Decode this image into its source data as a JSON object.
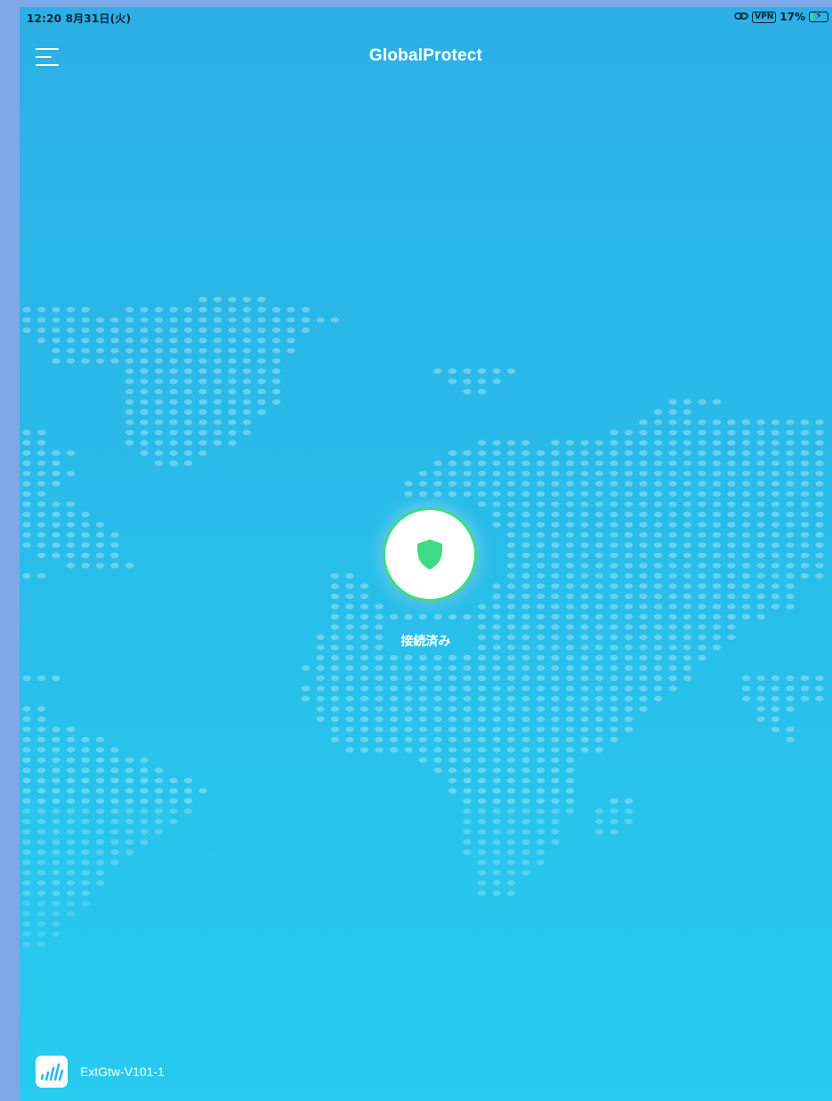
{
  "status_bar": {
    "time_date": "12:20  8月31日(火)",
    "vpn_badge": "VPN",
    "battery_percent": "17%",
    "battery_level": 0.17
  },
  "header": {
    "title": "GlobalProtect",
    "menu_icon": "hamburger-menu-icon"
  },
  "connection": {
    "status": "接続済み",
    "shield_icon": "shield-icon",
    "accent_color": "#3DDC84"
  },
  "gateway": {
    "name": "ExtGtw-V101-1",
    "icon": "signal-bars-icon"
  },
  "colors": {
    "background_top": "#2CB0E6",
    "background_bottom": "#27CBEE",
    "frame": "#7FA8E8"
  }
}
